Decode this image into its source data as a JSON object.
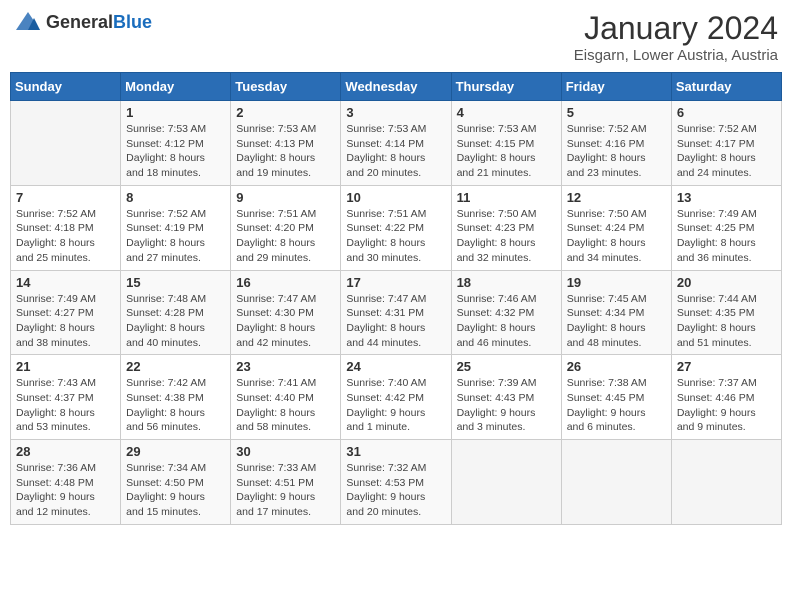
{
  "header": {
    "logo": {
      "general": "General",
      "blue": "Blue"
    },
    "title": "January 2024",
    "location": "Eisgarn, Lower Austria, Austria"
  },
  "calendar": {
    "days_of_week": [
      "Sunday",
      "Monday",
      "Tuesday",
      "Wednesday",
      "Thursday",
      "Friday",
      "Saturday"
    ],
    "weeks": [
      [
        {
          "day": "",
          "sunrise": "",
          "sunset": "",
          "daylight": ""
        },
        {
          "day": "1",
          "sunrise": "Sunrise: 7:53 AM",
          "sunset": "Sunset: 4:12 PM",
          "daylight": "Daylight: 8 hours and 18 minutes."
        },
        {
          "day": "2",
          "sunrise": "Sunrise: 7:53 AM",
          "sunset": "Sunset: 4:13 PM",
          "daylight": "Daylight: 8 hours and 19 minutes."
        },
        {
          "day": "3",
          "sunrise": "Sunrise: 7:53 AM",
          "sunset": "Sunset: 4:14 PM",
          "daylight": "Daylight: 8 hours and 20 minutes."
        },
        {
          "day": "4",
          "sunrise": "Sunrise: 7:53 AM",
          "sunset": "Sunset: 4:15 PM",
          "daylight": "Daylight: 8 hours and 21 minutes."
        },
        {
          "day": "5",
          "sunrise": "Sunrise: 7:52 AM",
          "sunset": "Sunset: 4:16 PM",
          "daylight": "Daylight: 8 hours and 23 minutes."
        },
        {
          "day": "6",
          "sunrise": "Sunrise: 7:52 AM",
          "sunset": "Sunset: 4:17 PM",
          "daylight": "Daylight: 8 hours and 24 minutes."
        }
      ],
      [
        {
          "day": "7",
          "sunrise": "Sunrise: 7:52 AM",
          "sunset": "Sunset: 4:18 PM",
          "daylight": "Daylight: 8 hours and 25 minutes."
        },
        {
          "day": "8",
          "sunrise": "Sunrise: 7:52 AM",
          "sunset": "Sunset: 4:19 PM",
          "daylight": "Daylight: 8 hours and 27 minutes."
        },
        {
          "day": "9",
          "sunrise": "Sunrise: 7:51 AM",
          "sunset": "Sunset: 4:20 PM",
          "daylight": "Daylight: 8 hours and 29 minutes."
        },
        {
          "day": "10",
          "sunrise": "Sunrise: 7:51 AM",
          "sunset": "Sunset: 4:22 PM",
          "daylight": "Daylight: 8 hours and 30 minutes."
        },
        {
          "day": "11",
          "sunrise": "Sunrise: 7:50 AM",
          "sunset": "Sunset: 4:23 PM",
          "daylight": "Daylight: 8 hours and 32 minutes."
        },
        {
          "day": "12",
          "sunrise": "Sunrise: 7:50 AM",
          "sunset": "Sunset: 4:24 PM",
          "daylight": "Daylight: 8 hours and 34 minutes."
        },
        {
          "day": "13",
          "sunrise": "Sunrise: 7:49 AM",
          "sunset": "Sunset: 4:25 PM",
          "daylight": "Daylight: 8 hours and 36 minutes."
        }
      ],
      [
        {
          "day": "14",
          "sunrise": "Sunrise: 7:49 AM",
          "sunset": "Sunset: 4:27 PM",
          "daylight": "Daylight: 8 hours and 38 minutes."
        },
        {
          "day": "15",
          "sunrise": "Sunrise: 7:48 AM",
          "sunset": "Sunset: 4:28 PM",
          "daylight": "Daylight: 8 hours and 40 minutes."
        },
        {
          "day": "16",
          "sunrise": "Sunrise: 7:47 AM",
          "sunset": "Sunset: 4:30 PM",
          "daylight": "Daylight: 8 hours and 42 minutes."
        },
        {
          "day": "17",
          "sunrise": "Sunrise: 7:47 AM",
          "sunset": "Sunset: 4:31 PM",
          "daylight": "Daylight: 8 hours and 44 minutes."
        },
        {
          "day": "18",
          "sunrise": "Sunrise: 7:46 AM",
          "sunset": "Sunset: 4:32 PM",
          "daylight": "Daylight: 8 hours and 46 minutes."
        },
        {
          "day": "19",
          "sunrise": "Sunrise: 7:45 AM",
          "sunset": "Sunset: 4:34 PM",
          "daylight": "Daylight: 8 hours and 48 minutes."
        },
        {
          "day": "20",
          "sunrise": "Sunrise: 7:44 AM",
          "sunset": "Sunset: 4:35 PM",
          "daylight": "Daylight: 8 hours and 51 minutes."
        }
      ],
      [
        {
          "day": "21",
          "sunrise": "Sunrise: 7:43 AM",
          "sunset": "Sunset: 4:37 PM",
          "daylight": "Daylight: 8 hours and 53 minutes."
        },
        {
          "day": "22",
          "sunrise": "Sunrise: 7:42 AM",
          "sunset": "Sunset: 4:38 PM",
          "daylight": "Daylight: 8 hours and 56 minutes."
        },
        {
          "day": "23",
          "sunrise": "Sunrise: 7:41 AM",
          "sunset": "Sunset: 4:40 PM",
          "daylight": "Daylight: 8 hours and 58 minutes."
        },
        {
          "day": "24",
          "sunrise": "Sunrise: 7:40 AM",
          "sunset": "Sunset: 4:42 PM",
          "daylight": "Daylight: 9 hours and 1 minute."
        },
        {
          "day": "25",
          "sunrise": "Sunrise: 7:39 AM",
          "sunset": "Sunset: 4:43 PM",
          "daylight": "Daylight: 9 hours and 3 minutes."
        },
        {
          "day": "26",
          "sunrise": "Sunrise: 7:38 AM",
          "sunset": "Sunset: 4:45 PM",
          "daylight": "Daylight: 9 hours and 6 minutes."
        },
        {
          "day": "27",
          "sunrise": "Sunrise: 7:37 AM",
          "sunset": "Sunset: 4:46 PM",
          "daylight": "Daylight: 9 hours and 9 minutes."
        }
      ],
      [
        {
          "day": "28",
          "sunrise": "Sunrise: 7:36 AM",
          "sunset": "Sunset: 4:48 PM",
          "daylight": "Daylight: 9 hours and 12 minutes."
        },
        {
          "day": "29",
          "sunrise": "Sunrise: 7:34 AM",
          "sunset": "Sunset: 4:50 PM",
          "daylight": "Daylight: 9 hours and 15 minutes."
        },
        {
          "day": "30",
          "sunrise": "Sunrise: 7:33 AM",
          "sunset": "Sunset: 4:51 PM",
          "daylight": "Daylight: 9 hours and 17 minutes."
        },
        {
          "day": "31",
          "sunrise": "Sunrise: 7:32 AM",
          "sunset": "Sunset: 4:53 PM",
          "daylight": "Daylight: 9 hours and 20 minutes."
        },
        {
          "day": "",
          "sunrise": "",
          "sunset": "",
          "daylight": ""
        },
        {
          "day": "",
          "sunrise": "",
          "sunset": "",
          "daylight": ""
        },
        {
          "day": "",
          "sunrise": "",
          "sunset": "",
          "daylight": ""
        }
      ]
    ]
  }
}
